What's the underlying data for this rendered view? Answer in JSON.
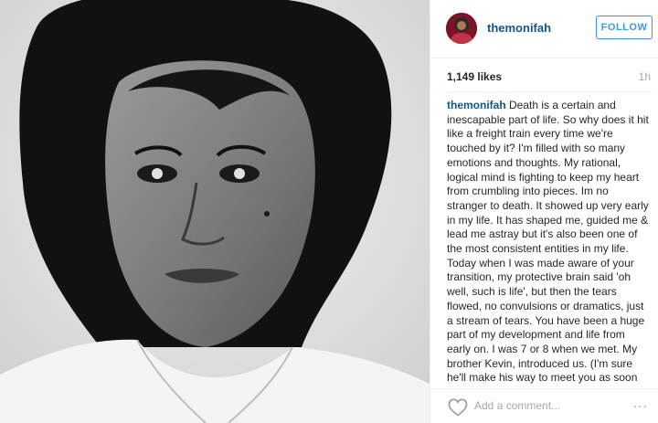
{
  "post": {
    "username": "themonifah",
    "follow_label": "FOLLOW",
    "likes": "1,149 likes",
    "time": "1h",
    "caption_user": "themonifah",
    "caption_text": "Death is a certain and inescapable part of life. So why does it hit like a freight train every time we're touched by it? I'm filled with so many emotions and thoughts. My rational, logical mind is fighting to keep my heart from crumbling into pieces. Im no stranger to death. It showed up very early in my life. It has shaped me, guided me & lead me astray but it's also been one of the most consistent entities in my life. Today when I was made aware of your transition, my protective brain said 'oh well, such is life', but then the tears flowed, no convulsions or dramatics, just a stream of tears. You have been a huge part of my development and life from early on. I was 7 or 8 when we met. My brother Kevin, introduced us. (I'm sure he'll make his way to meet you as soon as you settle into the proverbial 'up there') You were my first real crush. You",
    "comment_placeholder": "Add a comment...",
    "more_label": "...",
    "icons": {
      "heart": "heart-icon",
      "more": "more-options-icon"
    }
  },
  "colors": {
    "link": "#125688",
    "follow": "#3897f0",
    "muted": "#a5a7aa"
  }
}
